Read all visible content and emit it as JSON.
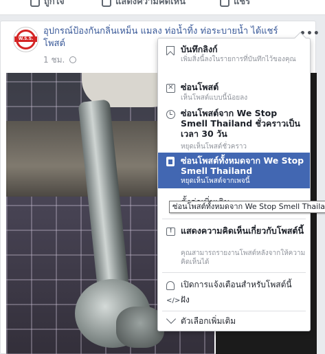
{
  "prev_post_actions": [
    {
      "label": "ถูกใจ",
      "icon": "like-icon"
    },
    {
      "label": "แสดงความคิดเห็น",
      "icon": "comment-icon"
    },
    {
      "label": "แชร์",
      "icon": "share-icon"
    }
  ],
  "post": {
    "title": "อุปกรณ์ป้องกันกลิ่นเหม็น แมลง ท่อน้ำทิ้ง ท่อระบายน้ำ ได้แชร์โพสต์",
    "avatar_text": "W.S.S.",
    "time": "1 ชม.",
    "more": "•••",
    "privacy_icon": "globe-icon"
  },
  "menu": {
    "items": [
      {
        "title": "บันทึกลิงก์",
        "subtitle": "เพิ่มสิ่งนี้ลงในรายการที่บันทึกไว้ของคุณ",
        "icon": "bookmark-icon"
      },
      {
        "title": "ซ่อนโพสต์",
        "subtitle": "เห็นโพสต์แบบนี้น้อยลง",
        "icon": "hide-post-icon"
      },
      {
        "title": "ซ่อนโพสต์จาก We Stop Smell Thailand ชั่วคราวเป็นเวลา 30 วัน",
        "subtitle": "หยุดเห็นโพสต์ชั่วคราว",
        "icon": "clock-icon"
      },
      {
        "title": "ซ่อนโพสต์ทั้งหมดจาก We Stop Smell Thailand",
        "subtitle": "หยุดเห็นโพสต์จากเพจนี้",
        "icon": "unfollow-icon"
      },
      {
        "title": "แสดงความคิดเห็นเกี่ยวกับโพสต์นี้",
        "subtitle": "คุณสามารถรายงานโพสต์หลังจากให้ความคิดเห็นได้",
        "icon": "feedback-icon"
      },
      {
        "title": "เปิดการแจ้งเตือนสำหรับโพสต์นี้",
        "icon": "bell-icon"
      },
      {
        "title": "ฝัง",
        "icon": "embed-icon"
      },
      {
        "title": "ตัวเลือกเพิ่มเติม",
        "icon": "chevron-down-icon"
      }
    ],
    "hidden_partial": "ตั้งค่าเพิ่มเติม"
  },
  "tooltip": "ซ่อนโพสต์ทั้งหมดจาก We Stop Smell Thailand",
  "colors": {
    "highlight": "#4267b2",
    "link": "#385898",
    "muted": "#90949c"
  }
}
